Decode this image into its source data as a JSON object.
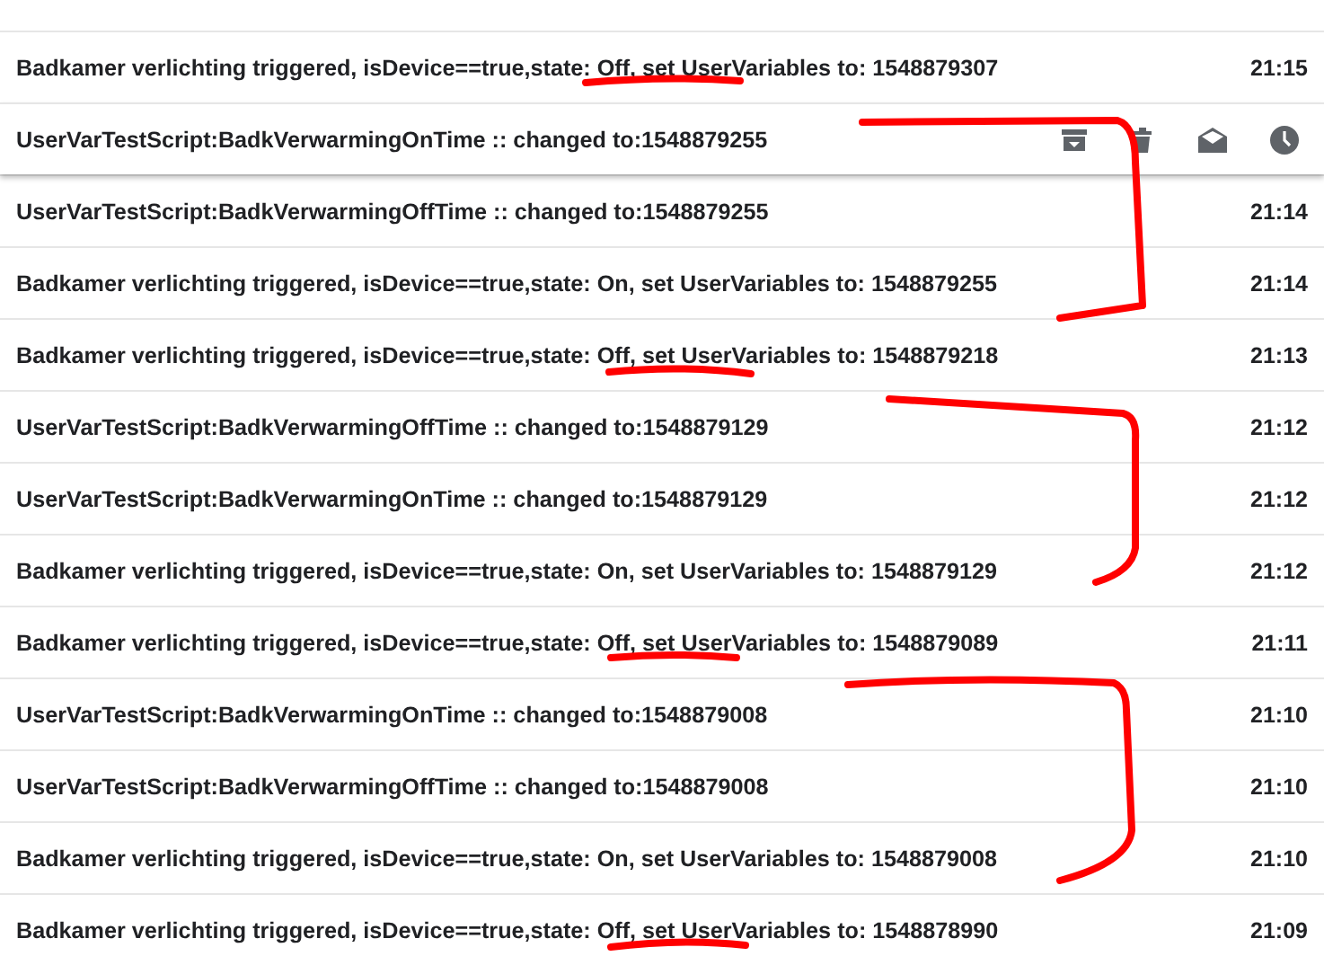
{
  "messages": [
    {
      "subject": "Badkamer verlichting triggered, isDevice==true,state: Off, set UserVariables to: 1548879307",
      "time": "21:15",
      "hovered": false
    },
    {
      "subject": "UserVarTestScript:BadkVerwarmingOnTime :: changed to:1548879255",
      "hovered": true
    },
    {
      "subject": "UserVarTestScript:BadkVerwarmingOffTime :: changed to:1548879255",
      "time": "21:14",
      "hovered": false
    },
    {
      "subject": "Badkamer verlichting triggered, isDevice==true,state: On, set UserVariables to: 1548879255",
      "time": "21:14",
      "hovered": false
    },
    {
      "subject": "Badkamer verlichting triggered, isDevice==true,state: Off, set UserVariables to: 1548879218",
      "time": "21:13",
      "hovered": false
    },
    {
      "subject": "UserVarTestScript:BadkVerwarmingOffTime :: changed to:1548879129",
      "time": "21:12",
      "hovered": false
    },
    {
      "subject": "UserVarTestScript:BadkVerwarmingOnTime :: changed to:1548879129",
      "time": "21:12",
      "hovered": false
    },
    {
      "subject": "Badkamer verlichting triggered, isDevice==true,state: On, set UserVariables to: 1548879129",
      "time": "21:12",
      "hovered": false
    },
    {
      "subject": "Badkamer verlichting triggered, isDevice==true,state: Off, set UserVariables to: 1548879089",
      "time": "21:11",
      "hovered": false
    },
    {
      "subject": "UserVarTestScript:BadkVerwarmingOnTime :: changed to:1548879008",
      "time": "21:10",
      "hovered": false
    },
    {
      "subject": "UserVarTestScript:BadkVerwarmingOffTime :: changed to:1548879008",
      "time": "21:10",
      "hovered": false
    },
    {
      "subject": "Badkamer verlichting triggered, isDevice==true,state: On, set UserVariables to: 1548879008",
      "time": "21:10",
      "hovered": false
    },
    {
      "subject": "Badkamer verlichting triggered, isDevice==true,state: Off, set UserVariables to: 1548878990",
      "time": "21:09",
      "hovered": false
    }
  ]
}
